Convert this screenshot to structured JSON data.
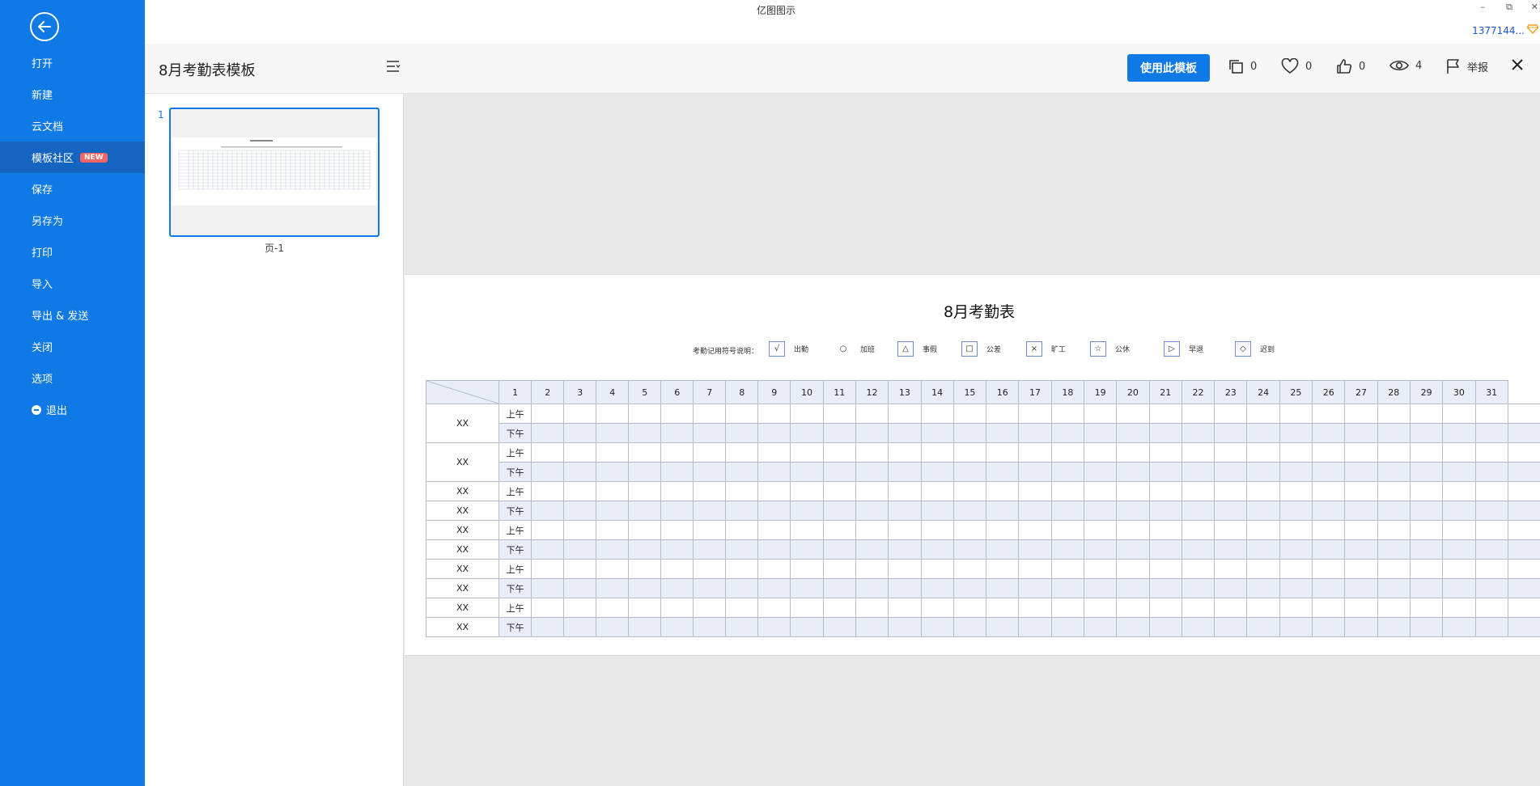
{
  "window": {
    "app_title": "亿图图示",
    "minimize": "–",
    "restore": "⧉",
    "close": "✕",
    "user_id": "1377144..."
  },
  "sidebar": {
    "items": [
      {
        "label": "打开"
      },
      {
        "label": "新建"
      },
      {
        "label": "云文档"
      },
      {
        "label": "模板社区",
        "badge": "NEW",
        "active": true
      },
      {
        "label": "保存"
      },
      {
        "label": "另存为"
      },
      {
        "label": "打印"
      },
      {
        "label": "导入"
      },
      {
        "label": "导出 & 发送"
      },
      {
        "label": "关闭"
      },
      {
        "label": "选项"
      },
      {
        "label": "退出"
      }
    ]
  },
  "header": {
    "title": "8月考勤表模板",
    "use_button": "使用此模板",
    "copies": "0",
    "favorites": "0",
    "likes": "0",
    "views": "4",
    "report": "举报"
  },
  "pages": {
    "number": "1",
    "label": "页-1"
  },
  "sheet": {
    "title": "8月考勤表",
    "legend_lead": "考勤记用符号说明：",
    "legend": [
      {
        "symbol": "√",
        "label": "出勤"
      },
      {
        "symbol": "○",
        "label": "加班"
      },
      {
        "symbol": "△",
        "label": "事假"
      },
      {
        "symbol": "□",
        "label": "公差"
      },
      {
        "symbol": "×",
        "label": "旷工"
      },
      {
        "symbol": "☆",
        "label": "公休"
      },
      {
        "symbol": "▷",
        "label": "早退"
      },
      {
        "symbol": "◇",
        "label": "迟到"
      }
    ],
    "days": [
      "1",
      "2",
      "3",
      "4",
      "5",
      "6",
      "7",
      "8",
      "9",
      "10",
      "11",
      "12",
      "13",
      "14",
      "15",
      "16",
      "17",
      "18",
      "19",
      "20",
      "21",
      "22",
      "23",
      "24",
      "25",
      "26",
      "27",
      "28",
      "29",
      "30",
      "31"
    ],
    "am_label": "上午",
    "pm_label": "下午",
    "rows": [
      {
        "name": "XX",
        "slot": "上午",
        "merged": true
      },
      {
        "name": "",
        "slot": "下午"
      },
      {
        "name": "XX",
        "slot": "上午",
        "merged": true
      },
      {
        "name": "",
        "slot": "下午"
      },
      {
        "name": "XX",
        "slot": "上午"
      },
      {
        "name": "XX",
        "slot": "下午"
      },
      {
        "name": "XX",
        "slot": "上午"
      },
      {
        "name": "XX",
        "slot": "下午"
      },
      {
        "name": "XX",
        "slot": "上午"
      },
      {
        "name": "XX",
        "slot": "下午"
      },
      {
        "name": "XX",
        "slot": "上午"
      },
      {
        "name": "XX",
        "slot": "下午"
      }
    ]
  },
  "colors": {
    "sidebar": "#0f7ae5",
    "sidebar_active": "#1465c2",
    "primary_button": "#0f7ae5",
    "badge": "#f56565",
    "table_header": "#e9edf8"
  }
}
